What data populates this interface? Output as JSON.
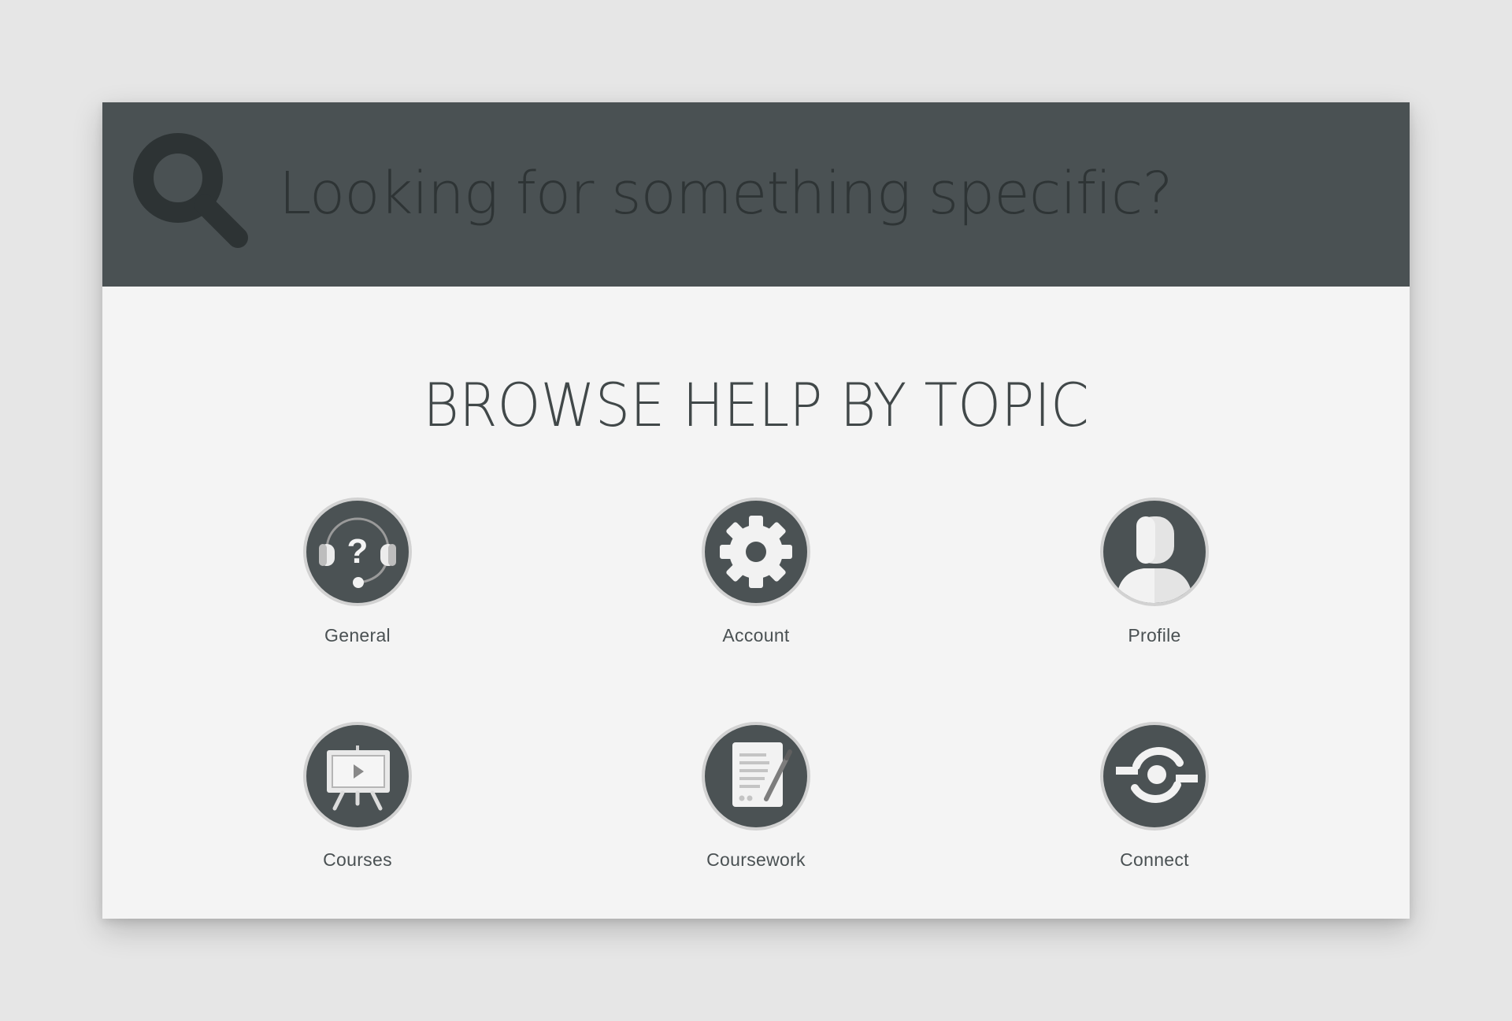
{
  "search": {
    "placeholder": "Looking for something specific?",
    "icon": "search-icon"
  },
  "browse": {
    "title": "BROWSE HELP BY TOPIC",
    "topics": [
      {
        "label": "General",
        "icon": "help-headset-icon"
      },
      {
        "label": "Account",
        "icon": "gear-icon"
      },
      {
        "label": "Profile",
        "icon": "user-icon"
      },
      {
        "label": "Courses",
        "icon": "presentation-easel-icon"
      },
      {
        "label": "Coursework",
        "icon": "document-pen-icon"
      },
      {
        "label": "Connect",
        "icon": "sync-connect-icon"
      }
    ]
  },
  "colors": {
    "page_background": "#e6e6e6",
    "card_background": "#f4f4f4",
    "header_background": "#4a5153",
    "icon_circle": "#4b5254",
    "icon_ring": "#d2d2d2",
    "text": "#4a5153"
  }
}
